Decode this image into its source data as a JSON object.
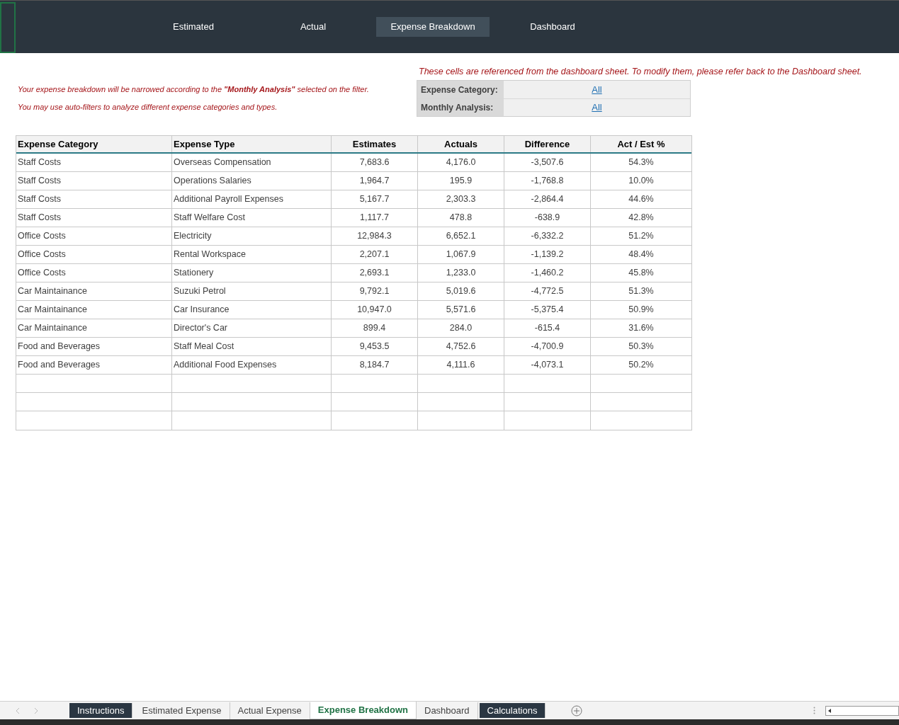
{
  "nav": [
    {
      "label": "Estimated",
      "selected": false
    },
    {
      "label": "Actual",
      "selected": false
    },
    {
      "label": "Expense Breakdown",
      "selected": true
    },
    {
      "label": "Dashboard",
      "selected": false
    }
  ],
  "notes": [
    "Your expense breakdown will be narrowed according to the **\"Monthly Analysis\"** selected on the filter.",
    "You may use auto-filters to analyze different expense categories and types."
  ],
  "filter_note": "These cells are referenced from the dashboard sheet. To modify them, please refer back to the Dashboard sheet.",
  "filters": [
    {
      "label": "Expense Category:",
      "value": "All"
    },
    {
      "label": "Monthly Analysis:",
      "value": "All"
    }
  ],
  "table": {
    "columns": [
      "Expense Category",
      "Expense Type",
      "Estimates",
      "Actuals",
      "Difference",
      "Act / Est %"
    ],
    "rows": [
      [
        "Staff Costs",
        "Overseas Compensation",
        "7,683.6",
        "4,176.0",
        "-3,507.6",
        "54.3%"
      ],
      [
        "Staff Costs",
        "Operations Salaries",
        "1,964.7",
        "195.9",
        "-1,768.8",
        "10.0%"
      ],
      [
        "Staff Costs",
        "Additional Payroll Expenses",
        "5,167.7",
        "2,303.3",
        "-2,864.4",
        "44.6%"
      ],
      [
        "Staff Costs",
        "Staff Welfare Cost",
        "1,117.7",
        "478.8",
        "-638.9",
        "42.8%"
      ],
      [
        "Office Costs",
        "Electricity",
        "12,984.3",
        "6,652.1",
        "-6,332.2",
        "51.2%"
      ],
      [
        "Office Costs",
        "Rental Workspace",
        "2,207.1",
        "1,067.9",
        "-1,139.2",
        "48.4%"
      ],
      [
        "Office Costs",
        "Stationery",
        "2,693.1",
        "1,233.0",
        "-1,460.2",
        "45.8%"
      ],
      [
        "Car Maintainance",
        "Suzuki Petrol",
        "9,792.1",
        "5,019.6",
        "-4,772.5",
        "51.3%"
      ],
      [
        "Car Maintainance",
        "Car Insurance",
        "10,947.0",
        "5,571.6",
        "-5,375.4",
        "50.9%"
      ],
      [
        "Car Maintainance",
        "Director's Car",
        "899.4",
        "284.0",
        "-615.4",
        "31.6%"
      ],
      [
        "Food and Beverages",
        "Staff Meal Cost",
        "9,453.5",
        "4,752.6",
        "-4,700.9",
        "50.3%"
      ],
      [
        "Food and Beverages",
        "Additional Food Expenses",
        "8,184.7",
        "4,111.6",
        "-4,073.1",
        "50.2%"
      ]
    ]
  },
  "sheet_tabs": [
    {
      "label": "Instructions",
      "selected": false,
      "kind": "dark"
    },
    {
      "label": "Estimated Expense",
      "selected": false,
      "kind": "plain"
    },
    {
      "label": "Actual Expense",
      "selected": false,
      "kind": "plain"
    },
    {
      "label": "Expense Breakdown",
      "selected": true,
      "kind": "plain"
    },
    {
      "label": "Dashboard",
      "selected": false,
      "kind": "plain"
    },
    {
      "label": "Calculations",
      "selected": false,
      "kind": "dark"
    }
  ]
}
